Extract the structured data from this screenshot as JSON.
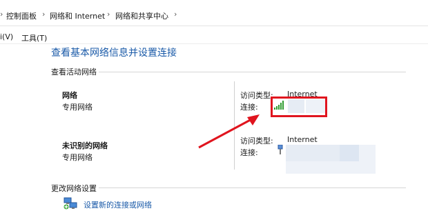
{
  "breadcrumb": {
    "items": [
      "控制面板",
      "网络和 Internet",
      "网络和共享中心"
    ]
  },
  "menu": {
    "items": [
      "i(V)",
      "工具(T)"
    ]
  },
  "main": {
    "title": "查看基本网络信息并设置连接",
    "active_section_label": "查看活动网络",
    "networks": [
      {
        "name": "网络",
        "type": "专用网络",
        "access_type_label": "访问类型:",
        "access_type_value": "Internet",
        "connection_label": "连接:"
      },
      {
        "name": "未识别的网络",
        "type": "专用网络",
        "access_type_label": "访问类型:",
        "access_type_value": "Internet",
        "connection_label": "连接:"
      }
    ],
    "change_section_label": "更改网络设置",
    "setup_link": "设置新的连接或网络"
  },
  "colors": {
    "link": "#1a5aa8",
    "highlight": "#e0141e",
    "arrow": "#e0141e",
    "signal": "#2e9b2e"
  },
  "icons": {
    "wifi_signal": "wifi-signal-icon",
    "ethernet": "ethernet-icon",
    "setup_connection": "network-setup-icon",
    "separator": "chevron-right-icon"
  }
}
